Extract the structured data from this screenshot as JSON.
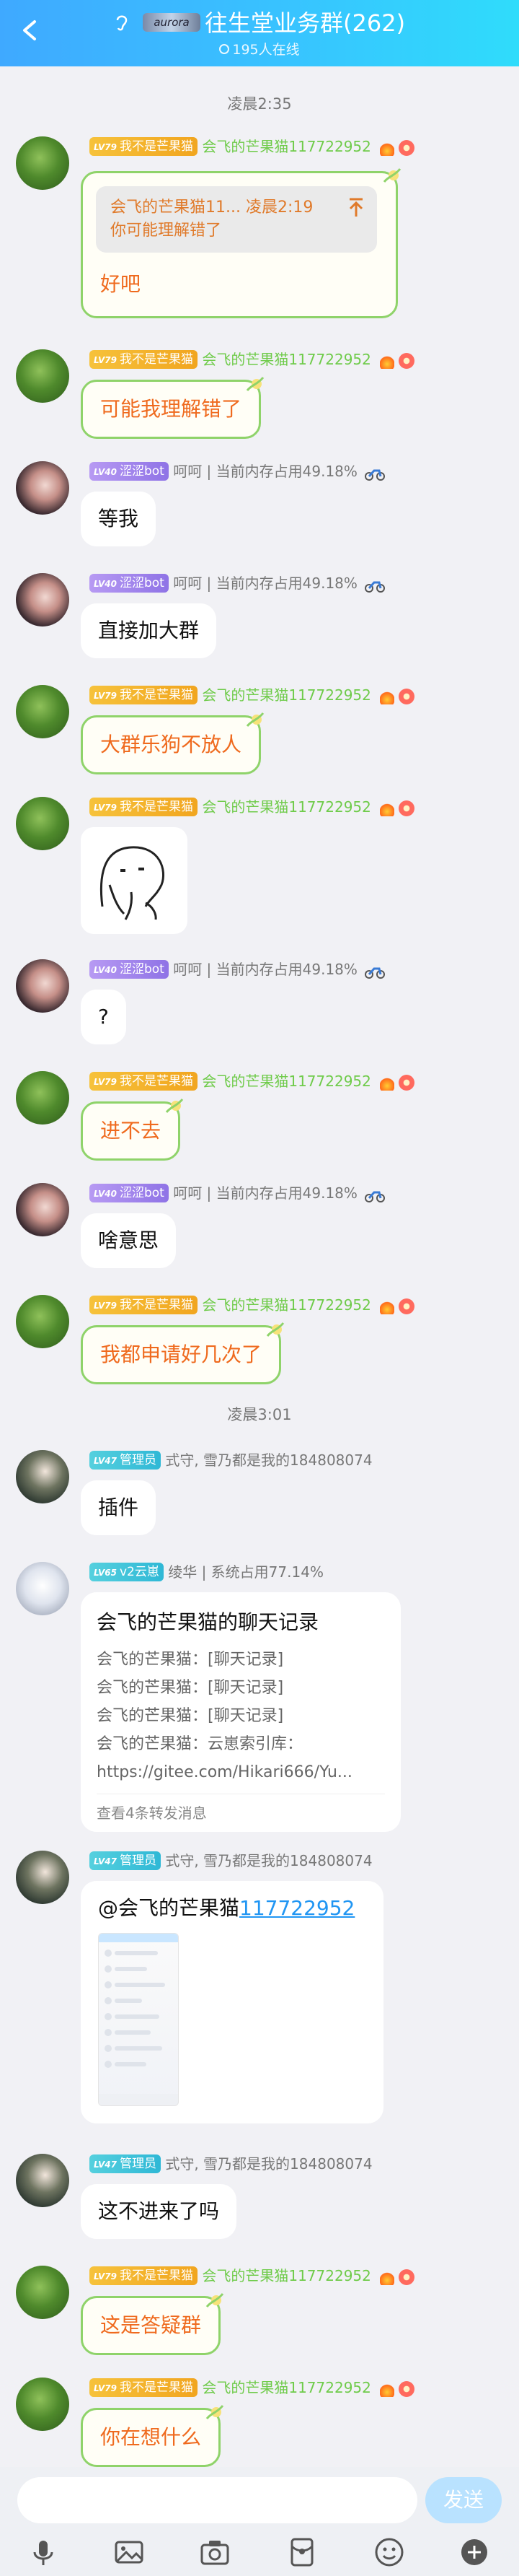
{
  "header": {
    "title": "往生堂业务群(262)",
    "logo_text": "aurora",
    "online": "195人在线"
  },
  "time_separators": [
    "凌晨2:35",
    "凌晨3:01"
  ],
  "users": {
    "mango": {
      "level": "LV79",
      "title": "我不是芒果猫",
      "nick": "会飞的芒果猫117722952"
    },
    "bot": {
      "level": "LV40",
      "title": "涩涩bot",
      "nick": "呵呵 | 当前内存占用49.18%"
    },
    "admin": {
      "level": "LV47",
      "title": "管理员",
      "nick": "式守, 雪乃都是我的184808074"
    },
    "yun": {
      "level": "LV65",
      "title": "v2云崽",
      "nick": "绫华 | 系统占用77.14%"
    }
  },
  "messages": {
    "m1": {
      "quote_head": "会飞的芒果猫11...  凌晨2:19",
      "quote_body": "你可能理解错了",
      "text": "好吧"
    },
    "m2": {
      "text": "可能我理解错了"
    },
    "m3": {
      "text": "等我"
    },
    "m4": {
      "text": "直接加大群"
    },
    "m5": {
      "text": "大群乐狗不放人"
    },
    "m7": {
      "text": "?"
    },
    "m8": {
      "text": "进不去"
    },
    "m9": {
      "text": "啥意思"
    },
    "m10": {
      "text": "我都申请好几次了"
    },
    "m11": {
      "text": "插件"
    },
    "m12": {
      "title": "会飞的芒果猫的聊天记录",
      "lines": [
        "会飞的芒果猫：[聊天记录]",
        "会飞的芒果猫：[聊天记录]",
        "会飞的芒果猫：[聊天记录]",
        "会飞的芒果猫：云崽索引库：",
        "https://gitee.com/Hikari666/Yu..."
      ],
      "footer": "查看4条转发消息"
    },
    "m13": {
      "mention": "@会飞的芒果猫",
      "mention_id": "117722952"
    },
    "m14": {
      "text": "这不进来了吗"
    },
    "m15": {
      "text": "这是答疑群"
    },
    "m16": {
      "text": "你在想什么"
    }
  },
  "input": {
    "placeholder": "",
    "send_label": "发送"
  },
  "toolbar": [
    "microphone-icon",
    "image-icon",
    "camera-icon",
    "red-packet-icon",
    "emoji-icon",
    "plus-icon"
  ],
  "colors": {
    "header_start": "#3fa9ff",
    "header_end": "#2fdcfb",
    "green_border": "#8fd36a",
    "orange_text": "#ef6a1e",
    "link": "#2196f3",
    "send_btn": "#b9e2ff"
  }
}
